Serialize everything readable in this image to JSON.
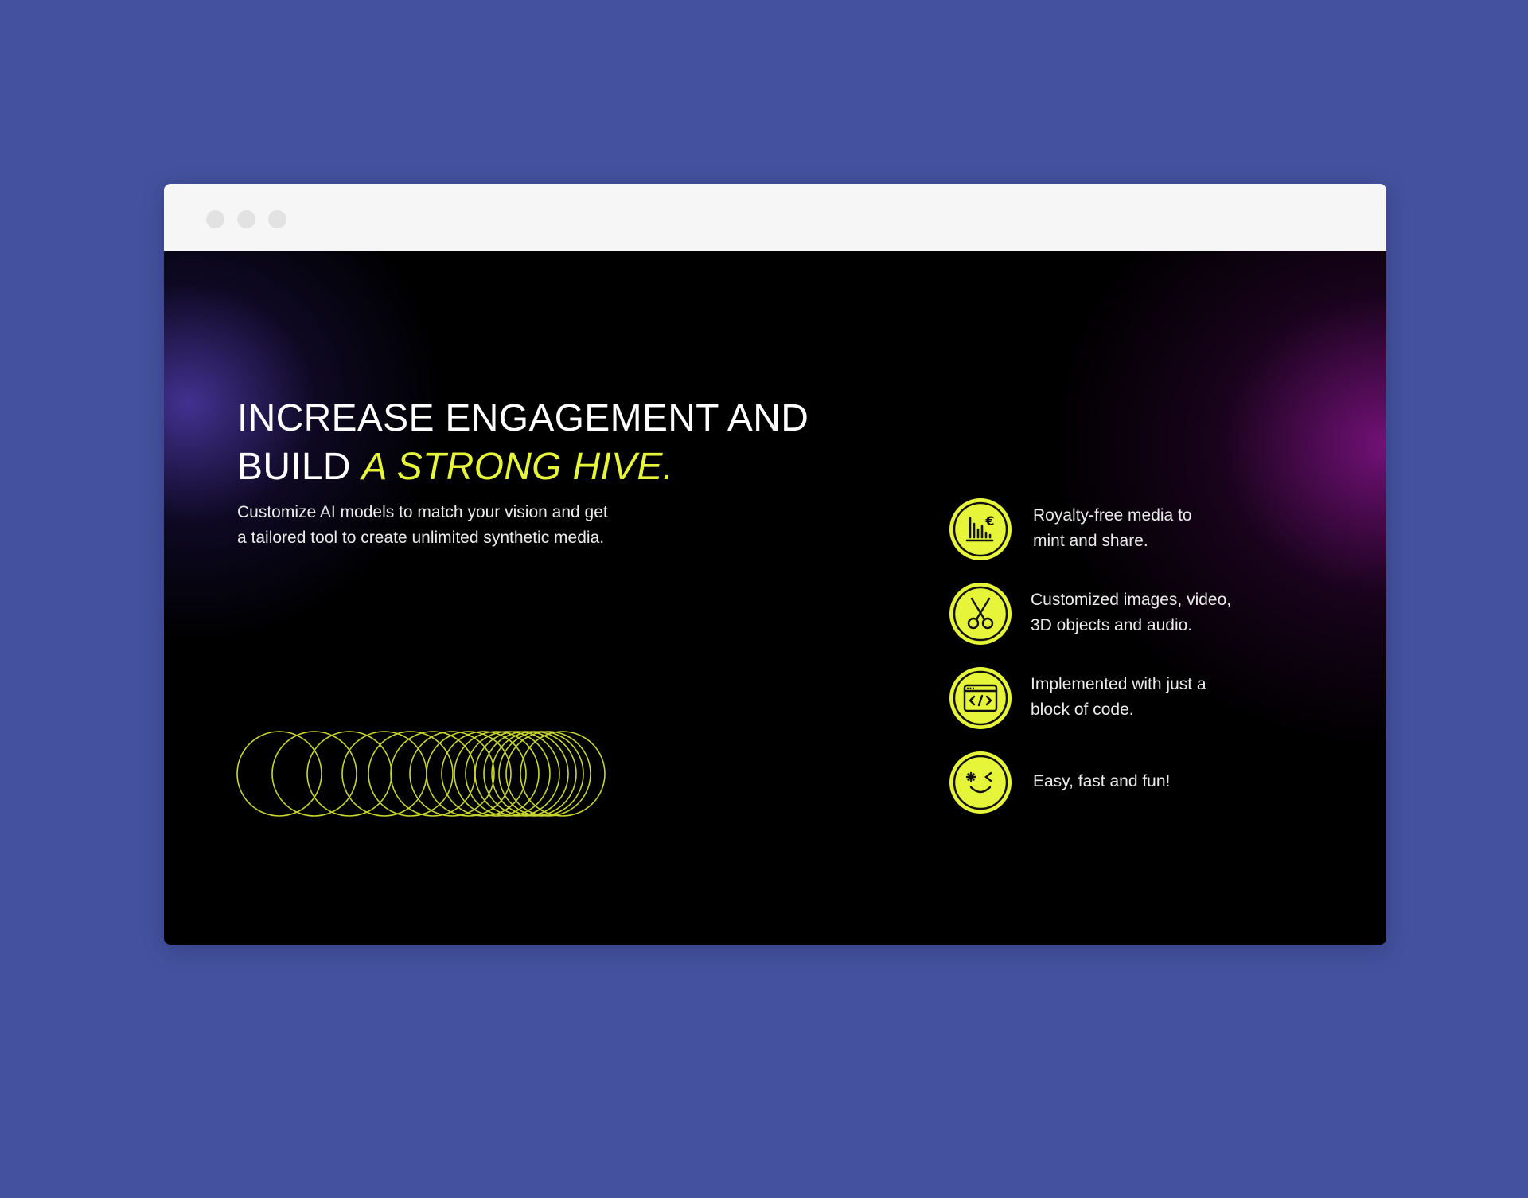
{
  "window": {
    "controls": [
      "window-dot",
      "window-dot",
      "window-dot"
    ]
  },
  "hero": {
    "headline_line1": "INCREASE ENGAGEMENT AND",
    "headline_line2_prefix": "BUILD ",
    "headline_line2_accent": "A STRONG HIVE.",
    "subtitle": "Customize AI models to match your vision and get a tailored tool to create unlimited synthetic media."
  },
  "features": [
    {
      "icon": "chart-euro-icon",
      "line1": "Royalty-free media to",
      "line2": "mint and share."
    },
    {
      "icon": "scissors-icon",
      "line1": "Customized images, video,",
      "line2": "3D objects and audio."
    },
    {
      "icon": "code-window-icon",
      "line1": "Implemented with just a",
      "line2": "block of code."
    },
    {
      "icon": "wink-face-icon",
      "line1": "Easy, fast and fun!",
      "line2": ""
    }
  ],
  "colors": {
    "background": "#43519f",
    "accent": "#e6f53a",
    "viewport": "#000000",
    "titlebar": "#f6f6f6"
  }
}
